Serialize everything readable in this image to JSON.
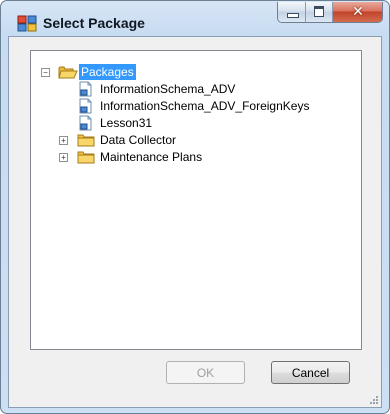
{
  "window": {
    "title": "Select Package"
  },
  "tree": {
    "root": {
      "label": "Packages",
      "expanded": true,
      "selected": true
    },
    "packages": [
      {
        "label": "InformationSchema_ADV"
      },
      {
        "label": "InformationSchema_ADV_ForeignKeys"
      },
      {
        "label": "Lesson31"
      }
    ],
    "folders": [
      {
        "label": "Data Collector",
        "expanded": false
      },
      {
        "label": "Maintenance Plans",
        "expanded": false
      }
    ]
  },
  "buttons": {
    "ok_label": "OK",
    "ok_enabled": false,
    "cancel_label": "Cancel"
  },
  "colors": {
    "selection": "#3399ff",
    "folder": "#f5c542",
    "title_bar": "#cddff3",
    "close_button": "#c2442a"
  }
}
